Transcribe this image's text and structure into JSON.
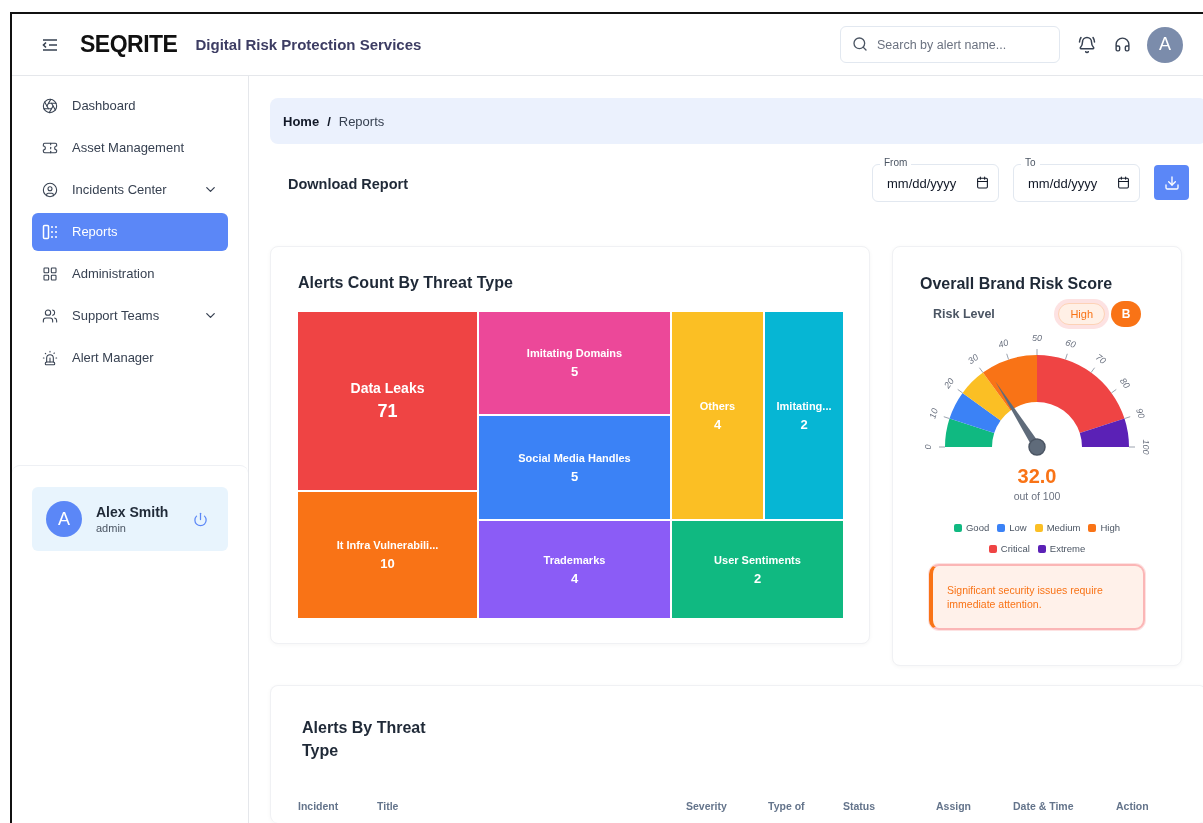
{
  "header": {
    "logo": "SEQRITE",
    "title": "Digital Risk Protection Services",
    "search": {
      "placeholder": "Search by alert name..."
    },
    "avatar": "A"
  },
  "sidebar": {
    "items": [
      {
        "label": "Dashboard",
        "selected": false,
        "expandable": false
      },
      {
        "label": "Asset Management",
        "selected": false,
        "expandable": false
      },
      {
        "label": "Incidents Center",
        "selected": false,
        "expandable": true
      },
      {
        "label": "Reports",
        "selected": true,
        "expandable": false
      },
      {
        "label": "Administration",
        "selected": false,
        "expandable": false
      },
      {
        "label": "Support Teams",
        "selected": false,
        "expandable": true
      },
      {
        "label": "Alert Manager",
        "selected": false,
        "expandable": false
      }
    ],
    "user": {
      "avatar": "A",
      "name": "Alex Smith",
      "role": "admin"
    }
  },
  "breadcrumb": [
    {
      "label": "Home"
    },
    {
      "label": "Reports"
    }
  ],
  "breadcrumb_separator": "/",
  "download": {
    "title": "Download Report",
    "fields": [
      {
        "label": "From",
        "placeholder": "mm/dd/yyyy"
      },
      {
        "label": "To",
        "placeholder": "mm/dd/yyyy"
      }
    ]
  },
  "treemap": {
    "title": "Alerts Count By Threat Type",
    "tiles": [
      {
        "label": "Data Leaks",
        "value": "71",
        "color": "#ef4444"
      },
      {
        "label": "It Infra Vulnerabili...",
        "value": "10",
        "color": "#f97316"
      },
      {
        "label": "Imitating Domains",
        "value": "5",
        "color": "#ec4899"
      },
      {
        "label": "Social Media Handles",
        "value": "5",
        "color": "#3b82f6"
      },
      {
        "label": "Trademarks",
        "value": "4",
        "color": "#8b5cf6"
      },
      {
        "label": "Others",
        "value": "4",
        "color": "#fbbf24"
      },
      {
        "label": "Imitating...",
        "value": "2",
        "color": "#06b6d4"
      },
      {
        "label": "User Sentiments",
        "value": "2",
        "color": "#10b981"
      }
    ]
  },
  "risk": {
    "title": "Overall Brand Risk Score",
    "risk_label": "Risk Level",
    "risk_value": "High",
    "grade": "B",
    "gauge": {
      "ticks": [
        "0",
        "10",
        "20",
        "30",
        "40",
        "50",
        "60",
        "70",
        "80",
        "90",
        "100"
      ]
    },
    "score": "32.0",
    "score_caption": "out of 100",
    "legend": [
      {
        "label": "Good",
        "color": "#10b981"
      },
      {
        "label": "Low",
        "color": "#3b82f6"
      },
      {
        "label": "Medium",
        "color": "#fbbf24"
      },
      {
        "label": "High",
        "color": "#f97316"
      },
      {
        "label": "Critical",
        "color": "#ef4444"
      },
      {
        "label": "Extreme",
        "color": "#5b21b6"
      }
    ],
    "message": "Significant security issues require immediate attention."
  },
  "alerts_table": {
    "title": "Alerts By Threat Type",
    "columns": [
      "Incident",
      "Title",
      "Severity",
      "Type of",
      "Status",
      "Assign",
      "Date & Time",
      "Action"
    ]
  }
}
